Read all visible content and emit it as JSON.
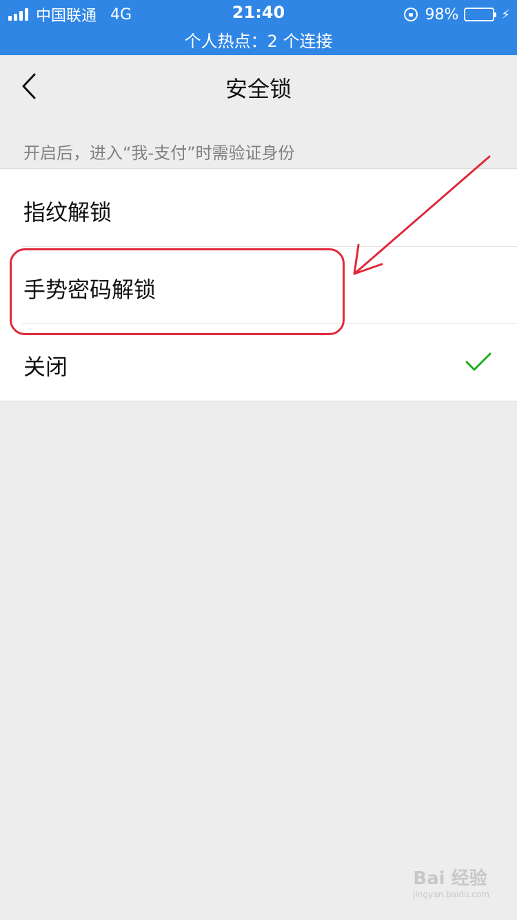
{
  "status_bar": {
    "carrier": "中国联通",
    "network": "4G",
    "time": "21:40",
    "battery": "98%",
    "battery_level": 0.98,
    "hotspot": "个人热点：2 个连接"
  },
  "nav": {
    "title": "安全锁"
  },
  "description": "开启后，进入“我-支付”时需验证身份",
  "options": [
    {
      "label": "指纹解锁",
      "selected": false
    },
    {
      "label": "手势密码解锁",
      "selected": false
    },
    {
      "label": "关闭",
      "selected": true
    }
  ],
  "colors": {
    "status_bar": "#2f86e5",
    "check": "#1aad19",
    "annotation": "#e0283a"
  },
  "watermark": {
    "main": "Bai 经验",
    "sub": "jingyan.baidu.com"
  }
}
